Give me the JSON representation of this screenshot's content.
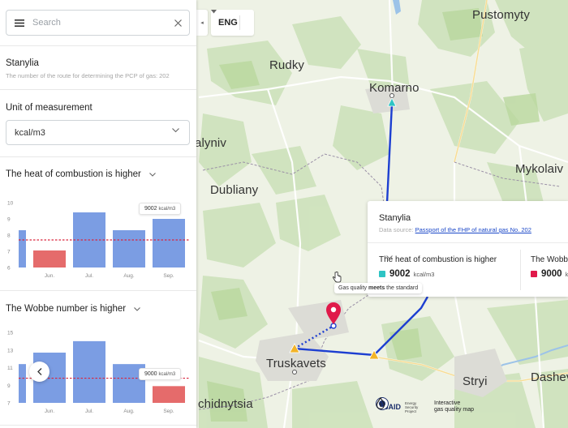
{
  "search": {
    "placeholder": "Search",
    "value": ""
  },
  "station": {
    "name": "Stanylia",
    "subtitle": "The number of the route for determining the PCP of gas: 202"
  },
  "unit_section": {
    "title": "Unit of measurement",
    "selected": "kcal/m3"
  },
  "chart1": {
    "title": "The heat of combustion is higher",
    "tooltip_value": "9002",
    "tooltip_unit": "kcal/m3",
    "y_ticks": [
      "10",
      "9",
      "8",
      "7",
      "6"
    ],
    "x_labels": [
      "Jun.",
      "Jul.",
      "Aug.",
      "Sep."
    ]
  },
  "chart2": {
    "title": "The Wobbe number is higher",
    "tooltip_value": "9000",
    "tooltip_unit": "kcal/m3",
    "y_ticks": [
      "15",
      "13",
      "11",
      "9",
      "7"
    ],
    "x_labels": [
      "Jun.",
      "Jul.",
      "Aug.",
      "Sep."
    ]
  },
  "chart_data": [
    {
      "type": "bar",
      "title": "The heat of combustion is higher",
      "categories": [
        "Jun.",
        "Jul.",
        "Aug.",
        "Sep."
      ],
      "values": [
        7.05,
        9.4,
        8.3,
        9.0
      ],
      "partial_leading_bar_value": 8.3,
      "reference_line": 7.7,
      "ylim": [
        6,
        10
      ],
      "bar_colors": [
        "#e56b6b",
        "#7b9de3",
        "#7b9de3",
        "#7b9de3"
      ],
      "reference_color": "#d9263f"
    },
    {
      "type": "bar",
      "title": "The Wobbe number is higher",
      "categories": [
        "Jun.",
        "Jul.",
        "Aug.",
        "Sep."
      ],
      "values": [
        12.7,
        14.0,
        11.4,
        8.9
      ],
      "partial_leading_bar_value": 11.4,
      "reference_line": 9.8,
      "ylim": [
        7,
        15
      ],
      "bar_colors": [
        "#7b9de3",
        "#7b9de3",
        "#7b9de3",
        "#e56b6b"
      ],
      "reference_color": "#d9263f"
    }
  ],
  "language": {
    "label": "ENG"
  },
  "map": {
    "cities": [
      "Pustomyty",
      "Rudky",
      "Komarno",
      "alyniv",
      "Mykolaiv",
      "Dubliany",
      "Truskavets",
      "Stryi",
      "Dasheva",
      "chidnytsia"
    ]
  },
  "popup": {
    "title": "Stanylia",
    "source_prefix": "Data source:",
    "source_link": "Passport of the FHP of natural gas No. 202",
    "col1_title": "The heat of combustion is higher",
    "col1_value": "9002",
    "col1_unit": "kcal/m3",
    "col1_color": "#2ec4c4",
    "col2_title": "The Wobbe",
    "col2_value": "9000",
    "col2_unit": "k",
    "col2_color": "#e0194a"
  },
  "quality_tooltip": {
    "prefix": "Gas quality",
    "bold": "meets",
    "suffix": "the standard"
  },
  "footer": {
    "usaid": "USAID",
    "project_line1": "Energy",
    "project_line2": "Security",
    "project_line3": "Project",
    "map_line1": "Interactive",
    "map_line2": "gas quality map"
  },
  "colors": {
    "route": "#1d3fd1",
    "accent_red": "#e0194a"
  }
}
